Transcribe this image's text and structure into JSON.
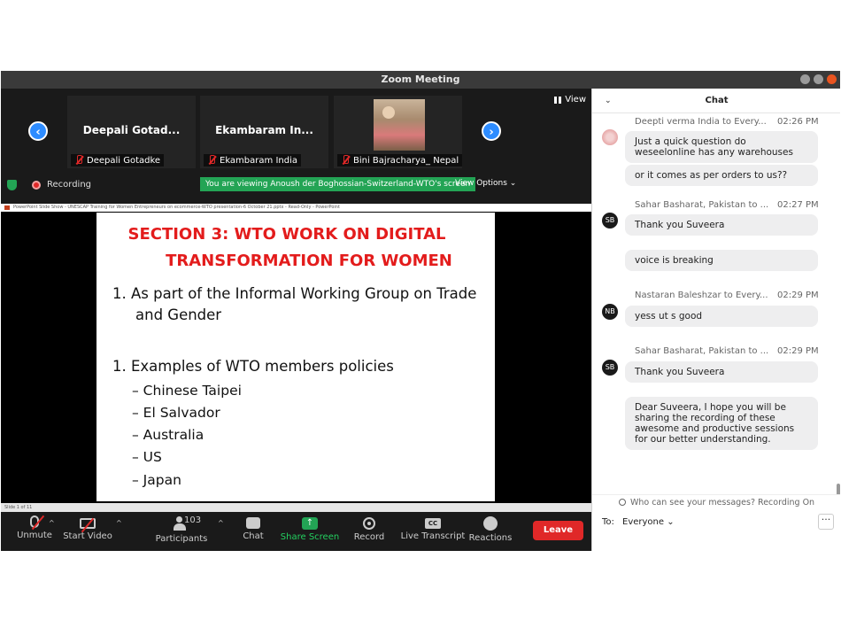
{
  "window": {
    "title": "Zoom Meeting"
  },
  "gallery": {
    "tiles": [
      {
        "name": "Deepali Gotad...",
        "label": "Deepali Gotadke"
      },
      {
        "name": "Ekambaram In...",
        "label": "Ekambaram India"
      },
      {
        "label": "Bini Bajracharya_ Nepal"
      }
    ],
    "prev": "‹",
    "next": "›",
    "view_label": "View"
  },
  "status": {
    "recording": "Recording",
    "viewing_banner": "You are viewing Anoush der Boghossian-Switzerland-WTO's screen",
    "view_options": "View Options ⌄"
  },
  "ppt": {
    "window_title": "PowerPoint Slide Show - UNESCAP Training for Women Entrepreneurs on ecommerce-WTO presentation-6 October 21.pptx - Read-Only - PowerPoint",
    "status_text": "Slide 1 of 11"
  },
  "slide": {
    "title_line1": "SECTION 3: WTO WORK ON DIGITAL",
    "title_line2": "TRANSFORMATION FOR WOMEN",
    "bullets": [
      {
        "line1": "1.  As part of the Informal Working Group on Trade",
        "line2": "and Gender"
      },
      {
        "line1": "1.  Examples of WTO members policies"
      }
    ],
    "sub_items": [
      "– Chinese Taipei",
      "– El Salvador",
      "– Australia",
      "– US",
      "– Japan"
    ]
  },
  "toolbar": {
    "unmute": "Unmute",
    "start_video": "Start Video",
    "participants": "Participants",
    "participants_count": "103",
    "chat": "Chat",
    "share_screen": "Share Screen",
    "record": "Record",
    "live_transcript": "Live Transcript",
    "live_transcript_icon": "CC",
    "reactions": "Reactions",
    "leave": "Leave"
  },
  "chat": {
    "title": "Chat",
    "messages": [
      {
        "sender": "Deepti verma India to Every...",
        "time": "02:26 PM",
        "text": "Just a quick question do weseelonline has any warehouses"
      },
      {
        "text": "or it comes as per orders to us??"
      },
      {
        "sender": "Sahar Basharat, Pakistan to ...",
        "time": "02:27 PM",
        "initials": "SB",
        "text": "Thank you Suveera"
      },
      {
        "text": "voice is breaking"
      },
      {
        "sender": "Nastaran Baleshzar to Every...",
        "time": "02:29 PM",
        "initials": "NB",
        "text": "yess ut s good"
      },
      {
        "sender": "Sahar Basharat, Pakistan to ...",
        "time": "02:29 PM",
        "initials": "SB",
        "text": "Thank you Suveera"
      },
      {
        "text": "Dear Suveera, I hope you will be sharing the recording of these awesome and productive sessions for our better understanding."
      }
    ],
    "who_can_see": "Who can see your messages? Recording On",
    "to_label": "To:",
    "to_value": "Everyone ⌄",
    "more": "···"
  }
}
